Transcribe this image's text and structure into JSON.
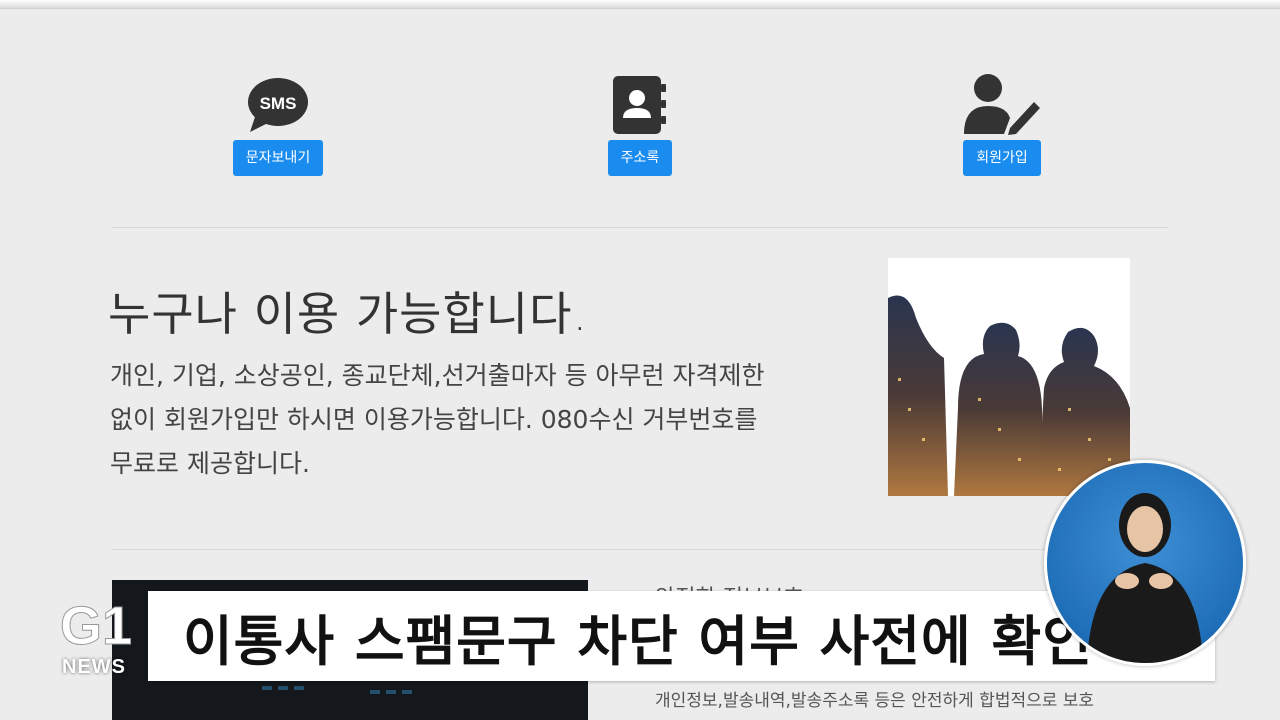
{
  "features": [
    {
      "icon": "sms-chat-icon",
      "label": "문자보내기"
    },
    {
      "icon": "address-book-icon",
      "label": "주소록"
    },
    {
      "icon": "user-edit-icon",
      "label": "회원가입"
    }
  ],
  "sms_icon_text": "SMS",
  "section1": {
    "headline": "누구나 이용 가능합니다.",
    "body": "개인, 기업, 소상공인, 종교단체,선거출마자 등 아무런 자격제한\n없이 회원가입만 하시면 이용가능합니다. 080수신 거부번호를\n무료로 제공합니다."
  },
  "section2": {
    "heading": "안전한 정보보호",
    "lines": [
      "개인정보,발송내역,발송주소록 등은 안전하게 합법적으로 보호"
    ]
  },
  "broadcast": {
    "caption": "이통사 스팸문구 차단 여부 사전에 확인",
    "logo_text": "G1",
    "news_text": "NEWS"
  },
  "colors": {
    "accent": "#1a8cf0",
    "icon": "#333333",
    "background": "#ececec"
  }
}
